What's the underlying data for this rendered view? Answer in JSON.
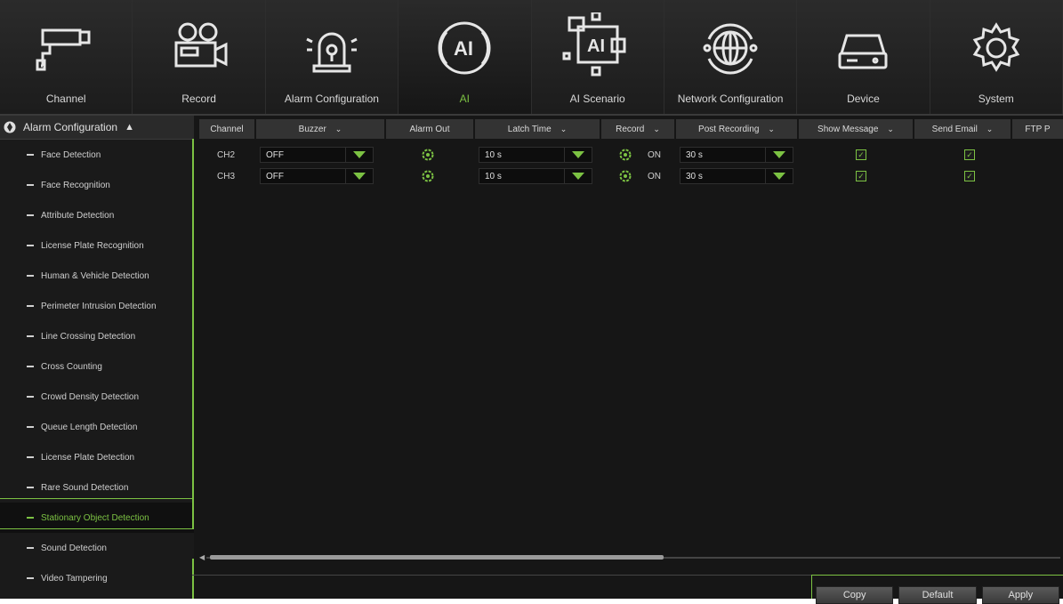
{
  "nav": {
    "items": [
      {
        "label": "Channel",
        "icon": "camera-icon",
        "active": false
      },
      {
        "label": "Record",
        "icon": "video-camera-icon",
        "active": false
      },
      {
        "label": "Alarm Configuration",
        "icon": "alarm-siren-icon",
        "active": false
      },
      {
        "label": "AI",
        "icon": "ai-head-icon",
        "active": true
      },
      {
        "label": "AI Scenario",
        "icon": "ai-scenario-icon",
        "active": false
      },
      {
        "label": "Network Configuration",
        "icon": "globe-network-icon",
        "active": false
      },
      {
        "label": "Device",
        "icon": "hdd-device-icon",
        "active": false
      },
      {
        "label": "System",
        "icon": "gear-system-icon",
        "active": false
      }
    ],
    "accent": "#7cc243"
  },
  "sidebar": {
    "header": "Alarm Configuration",
    "items": [
      {
        "label": "Face Detection"
      },
      {
        "label": "Face Recognition"
      },
      {
        "label": "Attribute Detection"
      },
      {
        "label": "License Plate Recognition"
      },
      {
        "label": "Human & Vehicle Detection"
      },
      {
        "label": "Perimeter Intrusion Detection"
      },
      {
        "label": "Line Crossing Detection"
      },
      {
        "label": "Cross Counting"
      },
      {
        "label": "Crowd Density Detection"
      },
      {
        "label": "Queue Length Detection"
      },
      {
        "label": "License Plate Detection"
      },
      {
        "label": "Rare Sound Detection"
      },
      {
        "label": "Stationary Object Detection",
        "active": true
      },
      {
        "label": "Sound Detection"
      },
      {
        "label": "Video Tampering"
      }
    ]
  },
  "table": {
    "columns": [
      {
        "label": "Channel",
        "dropdown": false
      },
      {
        "label": "Buzzer",
        "dropdown": true
      },
      {
        "label": "Alarm Out",
        "dropdown": false
      },
      {
        "label": "Latch Time",
        "dropdown": true
      },
      {
        "label": "Record",
        "dropdown": true
      },
      {
        "label": "Post Recording",
        "dropdown": true
      },
      {
        "label": "Show Message",
        "dropdown": true
      },
      {
        "label": "Send Email",
        "dropdown": true
      },
      {
        "label": "FTP P",
        "dropdown": false
      }
    ],
    "rows": [
      {
        "channel": "CH2",
        "buzzer": "OFF",
        "latch": "10 s",
        "record": "ON",
        "post": "30 s",
        "show_message": true,
        "send_email": true
      },
      {
        "channel": "CH3",
        "buzzer": "OFF",
        "latch": "10 s",
        "record": "ON",
        "post": "30 s",
        "show_message": true,
        "send_email": true
      }
    ]
  },
  "buttons": {
    "copy": "Copy",
    "default": "Default",
    "apply": "Apply"
  }
}
